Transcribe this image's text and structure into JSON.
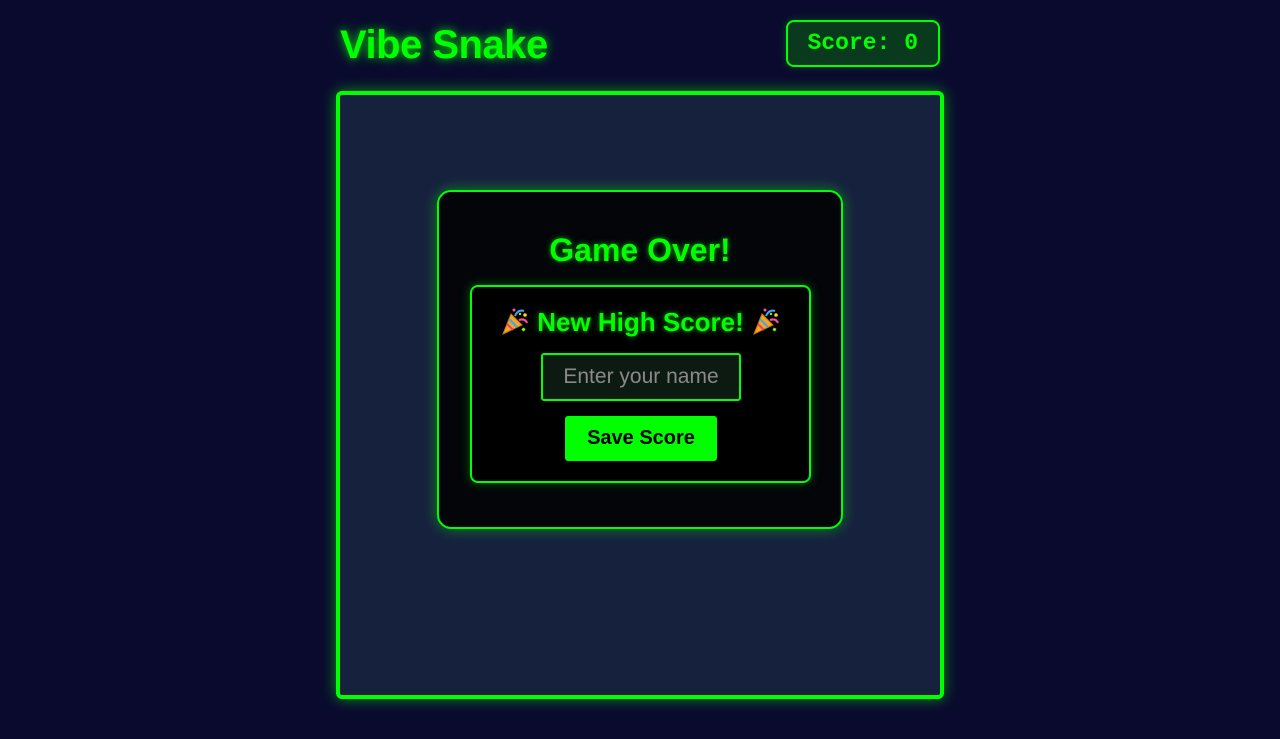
{
  "game": {
    "title": "Vibe Snake",
    "score_label": "Score:",
    "score_value": "0"
  },
  "overlay": {
    "title": "Game Over!",
    "high_score_heading": "New High Score!",
    "heading_icon": "party-popper-icon",
    "name_placeholder": "Enter your name",
    "name_value": "",
    "save_label": "Save Score"
  },
  "colors": {
    "background": "#0a0a2e",
    "board": "#16213e",
    "accent": "#00ff00",
    "score_box_bg": "#0a3a1e",
    "overlay_bg": "#000000"
  }
}
